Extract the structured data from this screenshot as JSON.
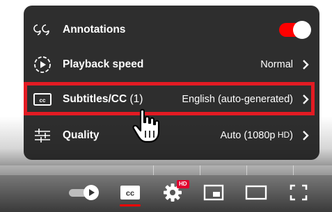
{
  "menu": {
    "annotations": {
      "label": "Annotations",
      "enabled": true
    },
    "playback_speed": {
      "label": "Playback speed",
      "value": "Normal"
    },
    "subtitles": {
      "label": "Subtitles/CC",
      "count": " (1)",
      "value": "English (auto-generated)"
    },
    "quality": {
      "label": "Quality",
      "value": "Auto (1080p",
      "value_suffix": " HD",
      "value_close": ")"
    }
  },
  "controls": {
    "settings_badge": "HD"
  },
  "colors": {
    "accent": "#ff0000",
    "highlight": "#e31b23",
    "menu_bg": "#1c1c1c"
  },
  "icons": [
    "annotations-icon",
    "playback-speed-icon",
    "subtitles-icon",
    "quality-icon",
    "chevron-right-icon",
    "autoplay-icon",
    "cc-icon",
    "gear-icon",
    "miniplayer-icon",
    "theater-icon",
    "fullscreen-icon",
    "hand-cursor-icon"
  ]
}
